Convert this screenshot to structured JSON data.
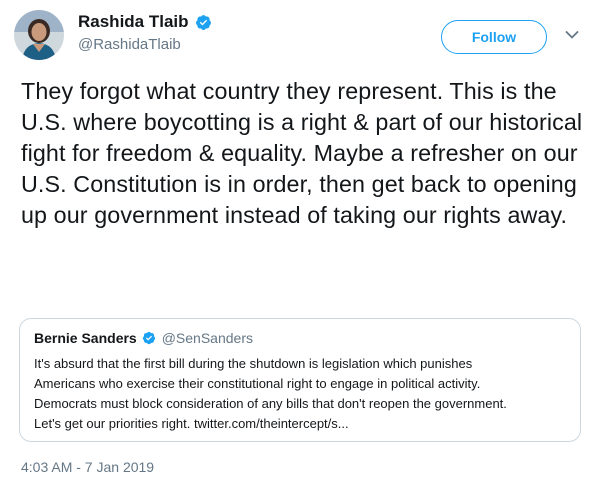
{
  "author": {
    "name": "Rashida Tlaib",
    "handle": "@RashidaTlaib",
    "verified": true
  },
  "follow_button": {
    "label": "Follow"
  },
  "menu_icon": "chevron-down-icon",
  "tweet": {
    "text": "They forgot what country they represent. This is the U.S. where boycotting is a right & part of our historical fight for freedom & equality. Maybe a refresher on our U.S. Constitution is in order, then get back to opening up our government instead of taking our rights away."
  },
  "quoted_tweet": {
    "author_name": "Bernie Sanders",
    "author_handle": "@SenSanders",
    "verified": true,
    "text": "It's absurd that the first bill during the shutdown is legislation which punishes\nAmericans who exercise their constitutional right to engage in political activity.\nDemocrats must block consideration of any bills that don't reopen the government.\nLet's get our priorities right. twitter.com/theintercept/s..."
  },
  "timestamp": "4:03 AM - 7 Jan 2019",
  "colors": {
    "accent": "#1da1f2",
    "text": "#14171a",
    "secondary": "#657786",
    "border": "#ccd6dd"
  }
}
